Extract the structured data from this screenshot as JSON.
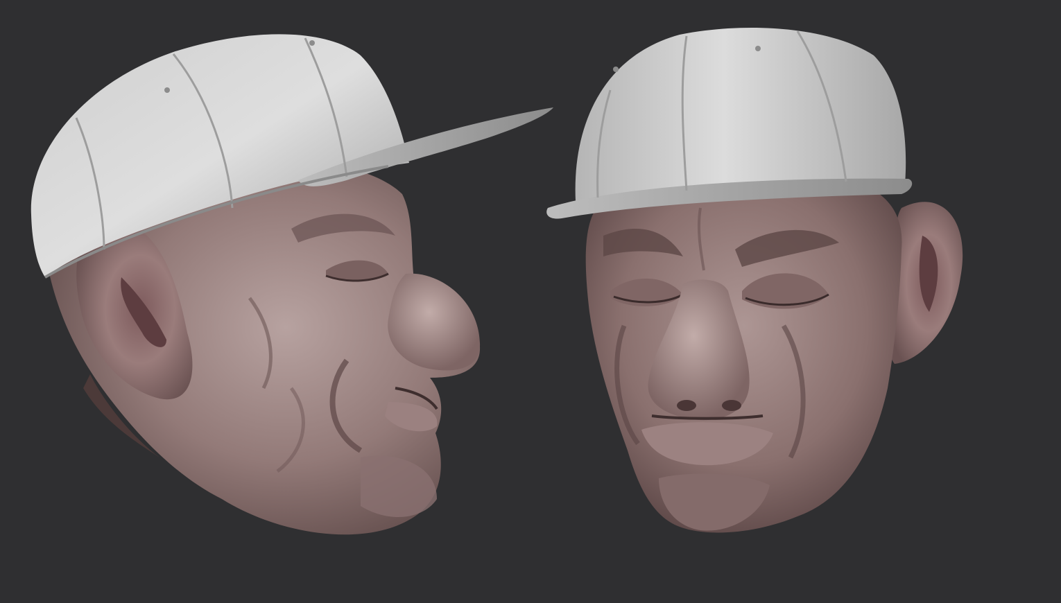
{
  "scene": {
    "background_color": "#2f2f31",
    "views": [
      {
        "id": "side-view",
        "subject": "sculpted-head-with-cap",
        "orientation": "profile-right"
      },
      {
        "id": "front-view",
        "subject": "sculpted-head-with-cap",
        "orientation": "three-quarter-front"
      }
    ],
    "colors": {
      "skin_light": "#b09a98",
      "skin_mid": "#8f7674",
      "skin_dark": "#5a4544",
      "cap_light": "#d8d8d8",
      "cap_mid": "#b9b9b9",
      "cap_dark": "#8a8a8a"
    }
  }
}
